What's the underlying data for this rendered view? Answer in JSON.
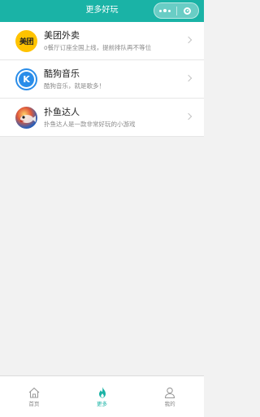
{
  "header": {
    "title": "更多好玩",
    "bg_color": "#1ab3a6",
    "more_icon": "more-dots-icon",
    "close_icon": "target-close-icon"
  },
  "list": {
    "items": [
      {
        "title": "美团外卖",
        "subtitle": "o餐厅订座全国上线，提前排队再不等位",
        "icon": "meituan-logo-icon",
        "icon_text": "美团"
      },
      {
        "title": "酷狗音乐",
        "subtitle": "酷狗音乐，就是歌多！",
        "icon": "kugou-logo-icon",
        "icon_text": "K"
      },
      {
        "title": "扑鱼达人",
        "subtitle": "扑鱼达人是一款非常好玩的小游戏",
        "icon": "fishing-game-icon"
      }
    ]
  },
  "tabbar": {
    "accent": "#1ab3a6",
    "tabs": [
      {
        "label": "首页",
        "icon": "home-icon",
        "active": false
      },
      {
        "label": "更多",
        "icon": "flame-icon",
        "active": true
      },
      {
        "label": "我的",
        "icon": "user-icon",
        "active": false
      }
    ]
  }
}
